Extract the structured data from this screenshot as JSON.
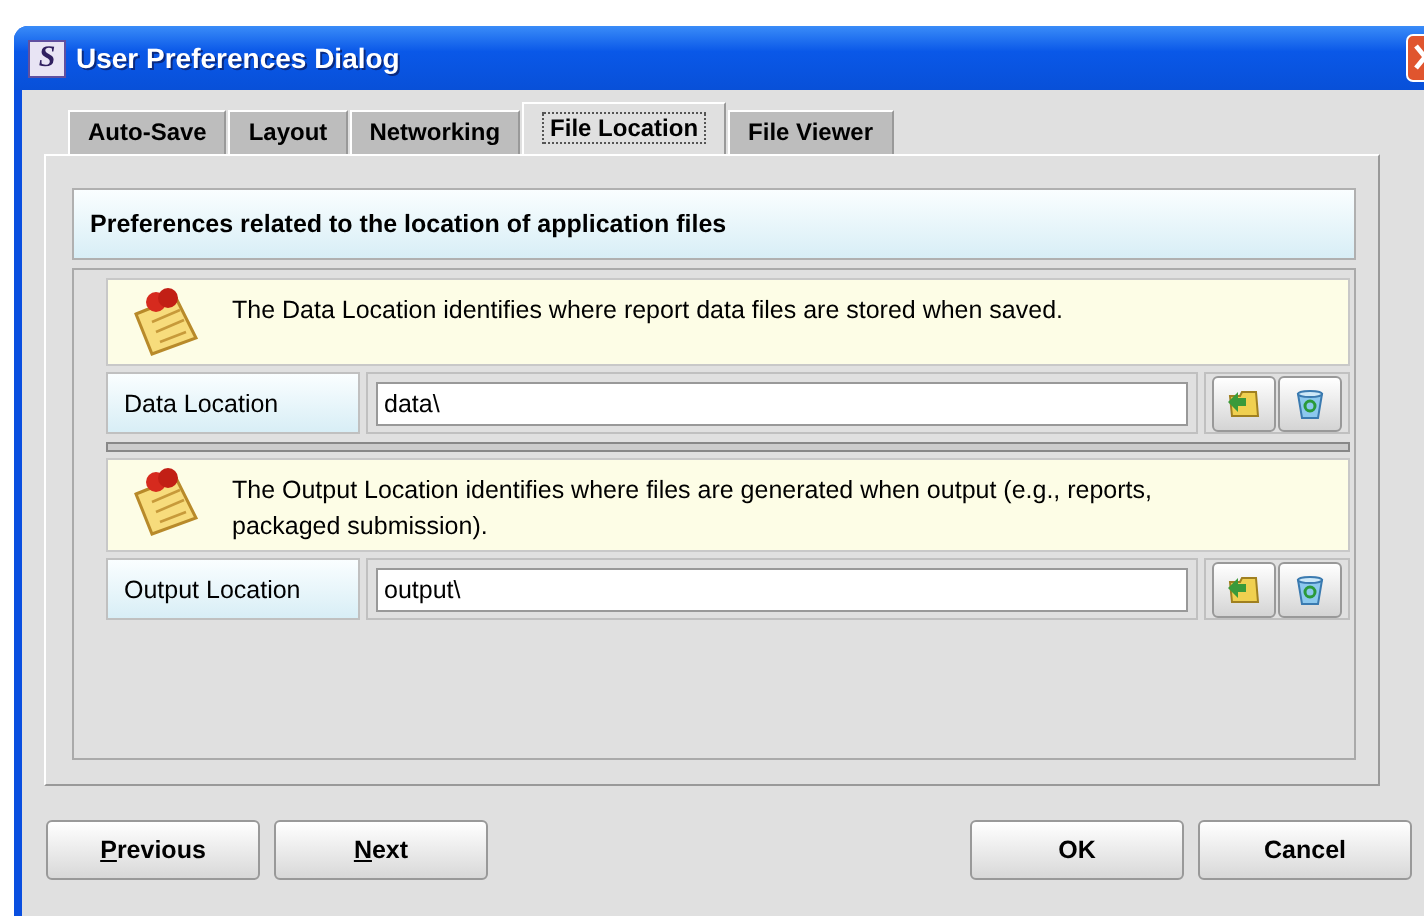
{
  "window": {
    "title": "User Preferences Dialog",
    "app_icon": "S"
  },
  "tabs": [
    {
      "label": "Auto-Save",
      "selected": false
    },
    {
      "label": "Layout",
      "selected": false
    },
    {
      "label": "Networking",
      "selected": false
    },
    {
      "label": "File Location",
      "selected": true
    },
    {
      "label": "File Viewer",
      "selected": false
    }
  ],
  "panel": {
    "heading": "Preferences related to the location of application files",
    "locations": [
      {
        "description": "The Data Location identifies where report data files are stored when saved.",
        "label": "Data Location",
        "value": "data\\"
      },
      {
        "description": "The Output Location identifies where files are generated when output (e.g., reports, packaged submission).",
        "label": "Output Location",
        "value": "output\\"
      }
    ]
  },
  "left_buttons": [
    {
      "label": "Previous",
      "underline_first": true
    },
    {
      "label": "Next",
      "underline_first": true
    }
  ],
  "right_buttons": [
    {
      "label": "OK",
      "underline_first": false
    },
    {
      "label": "Cancel",
      "underline_first": false
    }
  ]
}
